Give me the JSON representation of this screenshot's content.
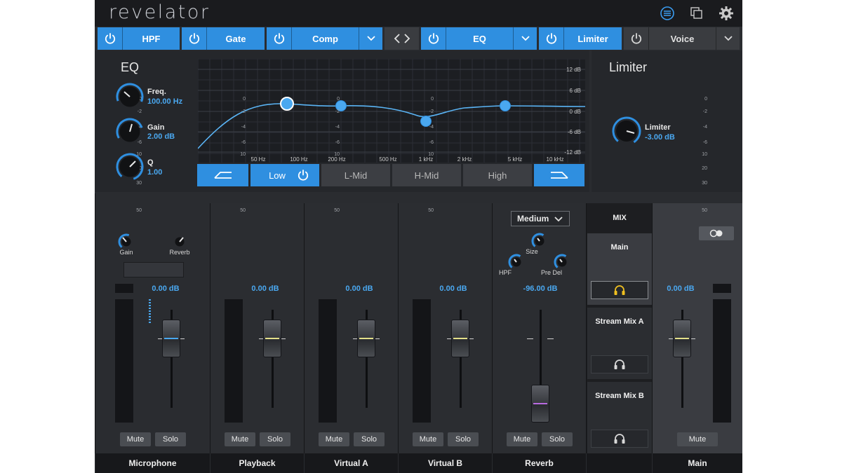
{
  "app": {
    "title": "revelator"
  },
  "toolbar_icons": [
    "mixer-icon",
    "copy-icon",
    "gear-icon"
  ],
  "modules": [
    {
      "label": "HPF",
      "on": true,
      "dropdown": false
    },
    {
      "label": "Gate",
      "on": true,
      "dropdown": false
    },
    {
      "label": "Comp",
      "on": true,
      "dropdown": true
    },
    {
      "label": "EQ",
      "on": true,
      "dropdown": true
    },
    {
      "label": "Limiter",
      "on": true,
      "dropdown": false
    },
    {
      "label": "Voice",
      "on": false,
      "dropdown": true
    }
  ],
  "eq": {
    "title": "EQ",
    "knobs": [
      {
        "label": "Freq.",
        "value": "100.00 Hz"
      },
      {
        "label": "Gain",
        "value": "2.00 dB"
      },
      {
        "label": "Q",
        "value": "1.00"
      }
    ],
    "db_labels": [
      "12 dB",
      "6 dB",
      "0 dB",
      "-6 dB",
      "-12 dB"
    ],
    "freq_labels": [
      "50 Hz",
      "100 Hz",
      "200 Hz",
      "500 Hz",
      "1 kHz",
      "2 kHz",
      "5 kHz",
      "10 kHz"
    ],
    "bands": [
      {
        "label": "",
        "icon": "high-pass-icon",
        "active": true
      },
      {
        "label": "Low",
        "icon": "power-icon",
        "active": true
      },
      {
        "label": "L-Mid",
        "active": false
      },
      {
        "label": "H-Mid",
        "active": false
      },
      {
        "label": "High",
        "active": false
      },
      {
        "label": "",
        "icon": "low-pass-icon",
        "active": true
      }
    ]
  },
  "limiter": {
    "title": "Limiter",
    "knob_label": "Limiter",
    "knob_value": "-3.00 dB"
  },
  "meter_scale": [
    "0",
    "-2",
    "-4",
    "-6",
    "10",
    "20",
    "30",
    "50"
  ],
  "channels": [
    {
      "name": "Microphone",
      "db": "0.00 dB",
      "knobs": [
        "Gain",
        "Reverb"
      ],
      "mute": "Mute",
      "solo": "Solo",
      "fader_color": "#4aa8f0"
    },
    {
      "name": "Playback",
      "db": "0.00 dB",
      "mute": "Mute",
      "solo": "Solo",
      "fader_color": "#e4e08a"
    },
    {
      "name": "Virtual A",
      "db": "0.00 dB",
      "mute": "Mute",
      "solo": "Solo",
      "fader_color": "#e4e08a"
    },
    {
      "name": "Virtual B",
      "db": "0.00 dB",
      "mute": "Mute",
      "solo": "Solo",
      "fader_color": "#e4e08a"
    },
    {
      "name": "Reverb",
      "db": "-96.00 dB",
      "preset": "Medium",
      "knobs": [
        "Size",
        "HPF",
        "Pre Del"
      ],
      "mute": "Mute",
      "solo": "Solo",
      "fader_color": "#b86ae0"
    }
  ],
  "mix": {
    "header": "MIX",
    "targets": [
      "Main",
      "Stream Mix A",
      "Stream Mix B"
    ]
  },
  "main": {
    "name": "Main",
    "db": "0.00 dB",
    "mute": "Mute",
    "fader_color": "#e4e08a"
  }
}
